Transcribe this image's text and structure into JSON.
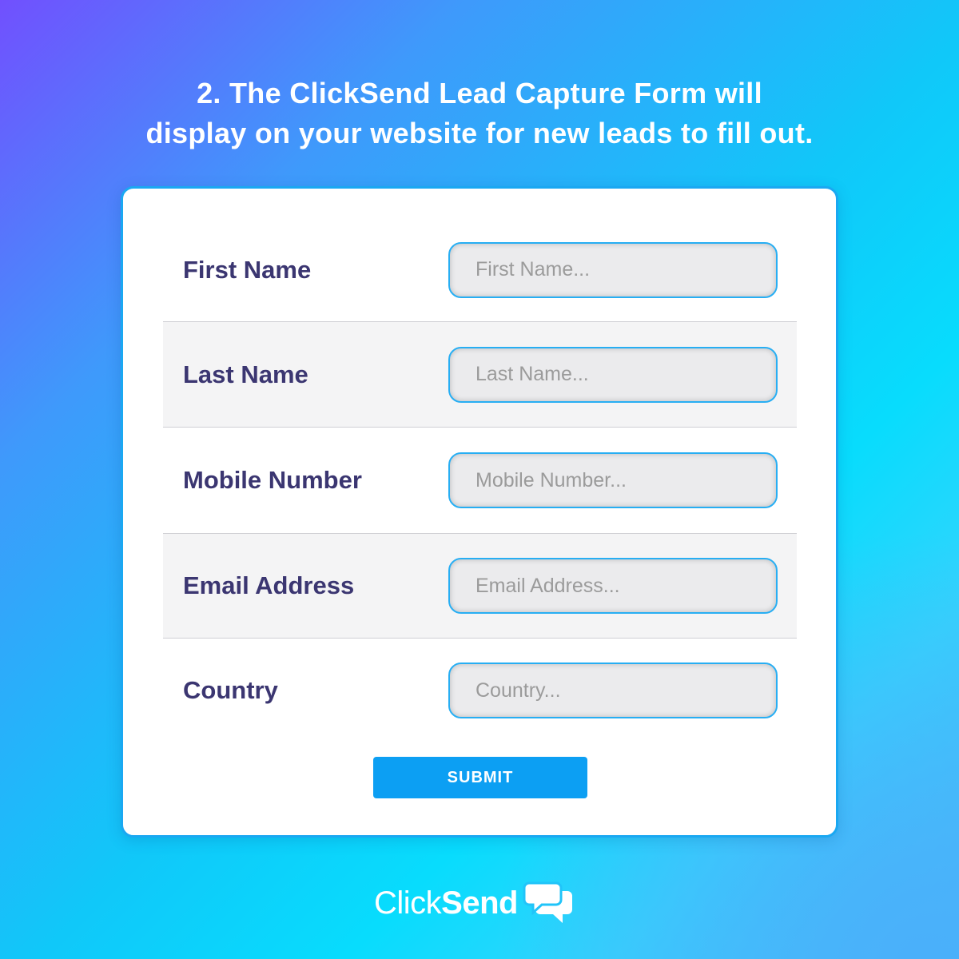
{
  "headline": {
    "line1": "2. The ClickSend Lead Capture Form will",
    "line2": "display on your website for new leads to fill out."
  },
  "form": {
    "fields": [
      {
        "label": "First Name",
        "placeholder": "First Name..."
      },
      {
        "label": "Last Name",
        "placeholder": "Last Name..."
      },
      {
        "label": "Mobile Number",
        "placeholder": "Mobile Number..."
      },
      {
        "label": "Email Address",
        "placeholder": "Email Address..."
      },
      {
        "label": "Country",
        "placeholder": "Country..."
      }
    ],
    "submit_label": "SUBMIT"
  },
  "brand": {
    "name_light": "Click",
    "name_bold": "Send",
    "icon": "chat-bubbles-icon"
  },
  "colors": {
    "accent": "#0c9ff3",
    "field_border": "#27aef3",
    "label_text": "#3b3671",
    "alt_row_background": "#f4f4f5"
  }
}
